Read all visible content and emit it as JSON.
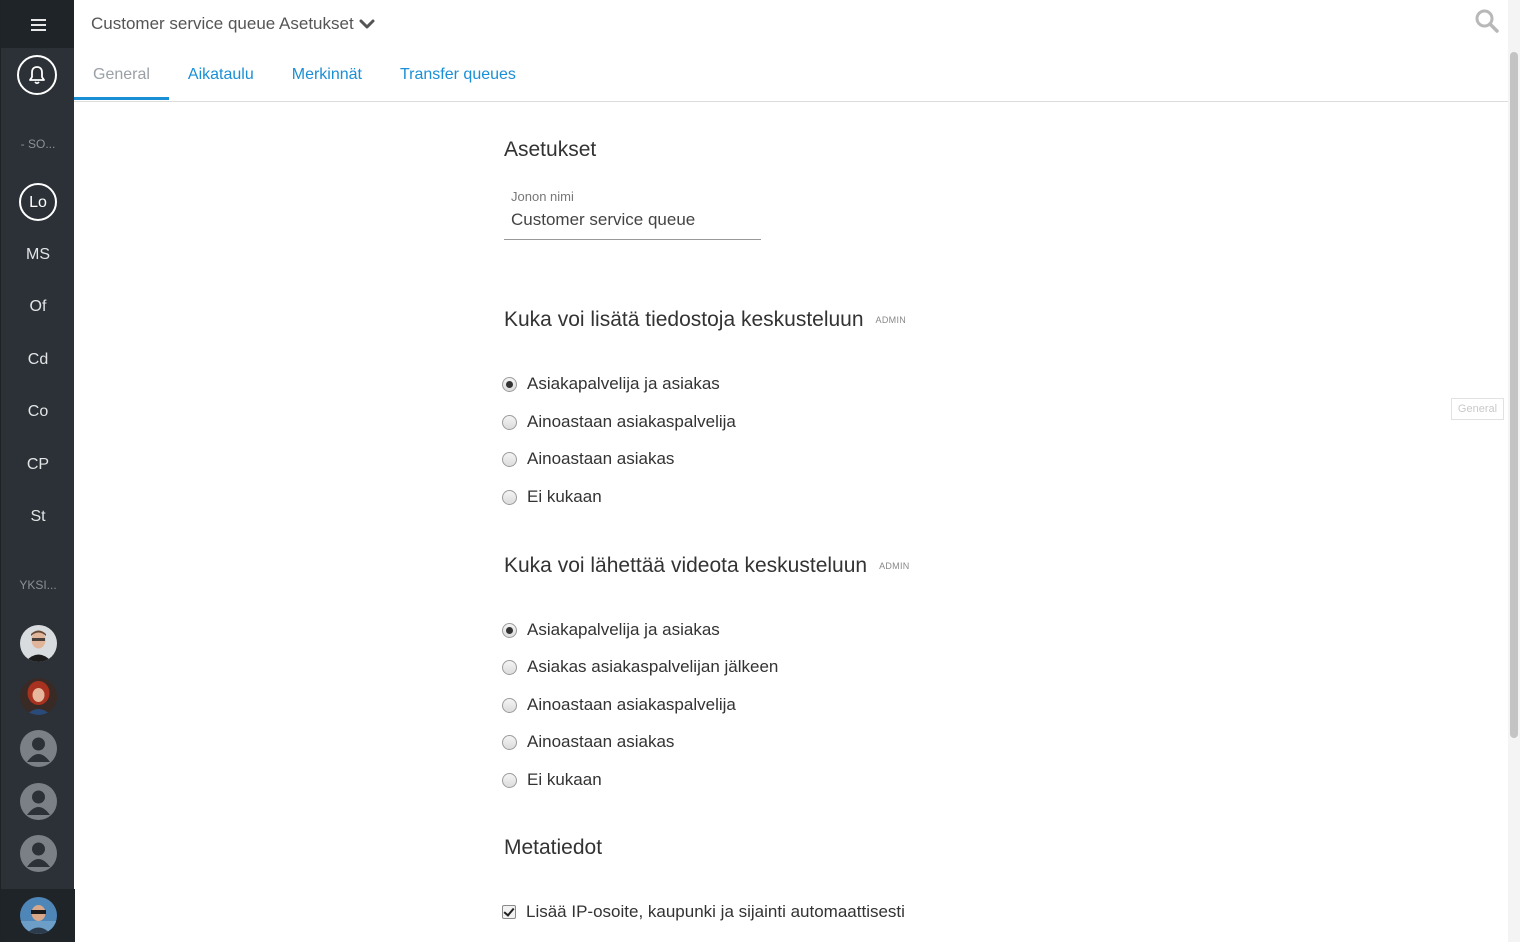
{
  "header": {
    "title": "Customer service queue Asetukset",
    "chevron_icon": "chevron-down-icon",
    "search_icon": "search-icon"
  },
  "tabs": [
    {
      "label": "General",
      "active": true
    },
    {
      "label": "Aikataulu",
      "active": false
    },
    {
      "label": "Merkinnät",
      "active": false
    },
    {
      "label": "Transfer queues",
      "active": false
    }
  ],
  "sidebar": {
    "menu_icon": "hamburger-menu-icon",
    "bell_icon": "bell-icon",
    "section_1": "- SO...",
    "items": [
      {
        "label": "Lo",
        "active": true
      },
      {
        "label": "MS"
      },
      {
        "label": "Of"
      },
      {
        "label": "Cd"
      },
      {
        "label": "Co"
      },
      {
        "label": "CP"
      },
      {
        "label": "St"
      }
    ],
    "section_2": "YKSI...",
    "avatars": [
      "avatar-user-1",
      "avatar-user-2",
      "avatar-generic",
      "avatar-generic",
      "avatar-generic",
      "avatar-current-user"
    ]
  },
  "settings": {
    "heading": "Asetukset",
    "queue_name_label": "Jonon nimi",
    "queue_name_value": "Customer service queue",
    "files": {
      "heading": "Kuka voi lisätä tiedostoja keskusteluun",
      "badge": "ADMIN",
      "options": [
        {
          "label": "Asiakapalvelija ja asiakas",
          "checked": true
        },
        {
          "label": "Ainoastaan asiakaspalvelija",
          "checked": false
        },
        {
          "label": "Ainoastaan asiakas",
          "checked": false
        },
        {
          "label": "Ei kukaan",
          "checked": false
        }
      ]
    },
    "video": {
      "heading": "Kuka voi lähettää videota keskusteluun",
      "badge": "ADMIN",
      "options": [
        {
          "label": "Asiakapalvelija ja asiakas",
          "checked": true
        },
        {
          "label": "Asiakas asiakaspalvelijan jälkeen",
          "checked": false
        },
        {
          "label": "Ainoastaan asiakaspalvelija",
          "checked": false
        },
        {
          "label": "Ainoastaan asiakas",
          "checked": false
        },
        {
          "label": "Ei kukaan",
          "checked": false
        }
      ]
    },
    "meta": {
      "heading": "Metatiedot",
      "checkbox_label": "Lisää IP-osoite, kaupunki ja sijainti automaattisesti",
      "checked": true
    }
  },
  "float_tag": "General",
  "colors": {
    "sidebar": "#2b3137",
    "accent": "#1a8fd6"
  }
}
